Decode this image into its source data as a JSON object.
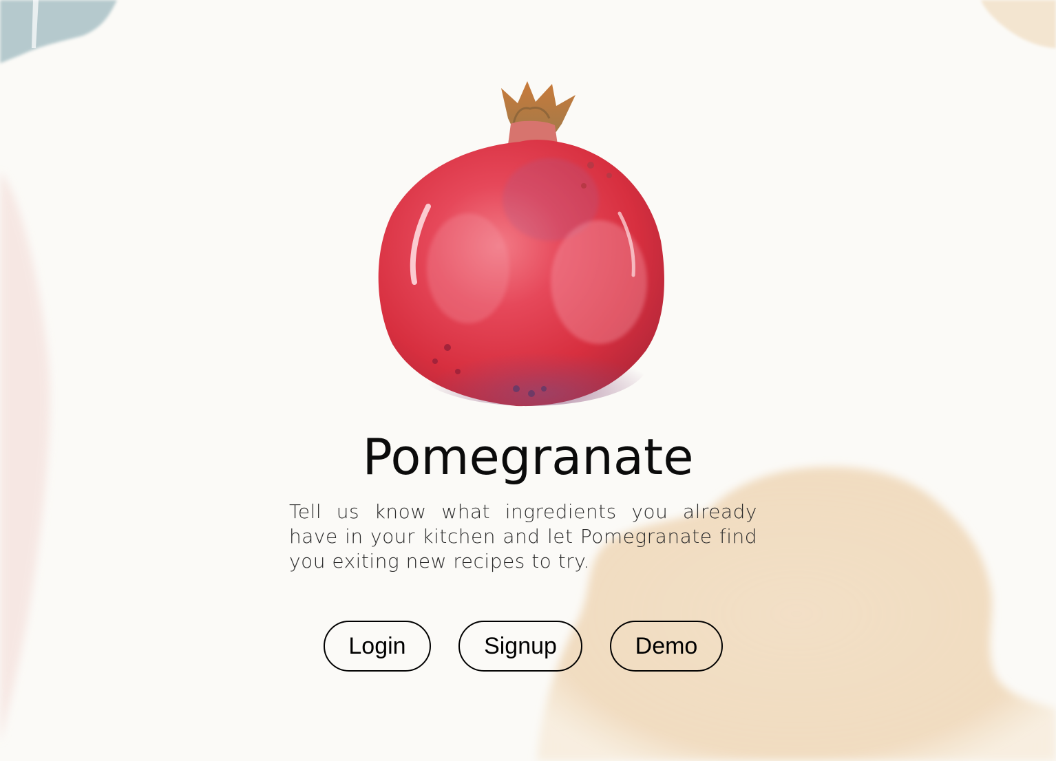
{
  "app": {
    "title": "Pomegranate",
    "tagline": "Tell us know what ingredients you already have in your kitchen and let Pomegranate find you exiting new recipes to try."
  },
  "buttons": {
    "login_label": "Login",
    "signup_label": "Signup",
    "demo_label": "Demo"
  },
  "colors": {
    "background": "#fbfaf7",
    "fruit_red": "#d9323e",
    "accent_beige": "#f0dcc0",
    "accent_blue": "#9fb8bd",
    "text": "#0b0b0b"
  }
}
